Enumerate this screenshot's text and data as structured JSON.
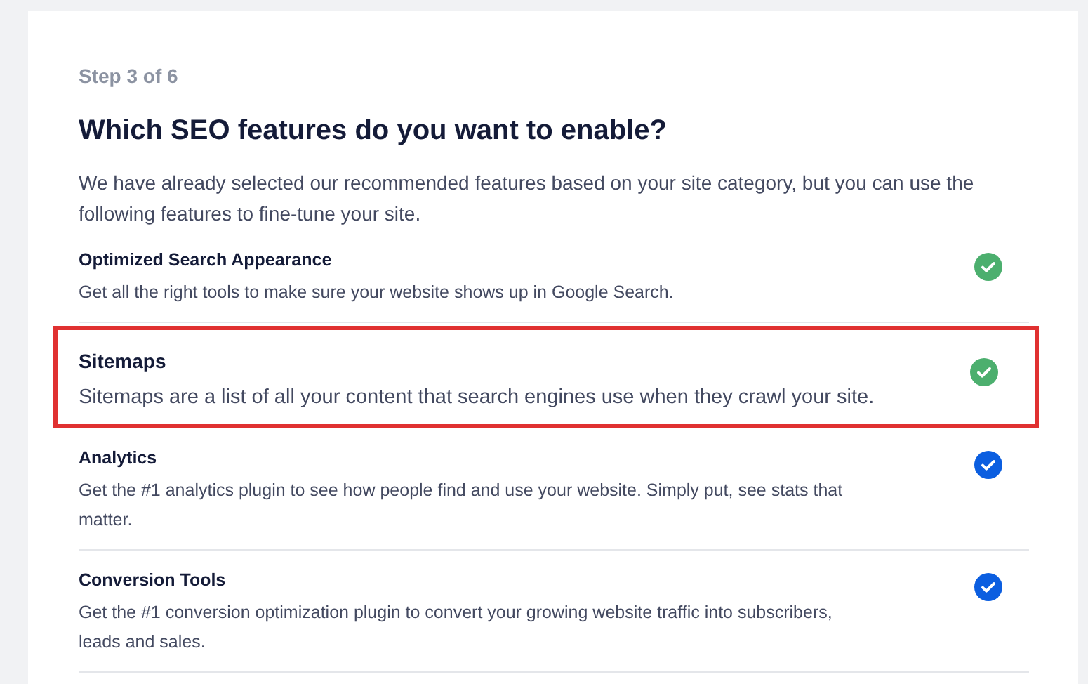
{
  "step": "Step 3 of 6",
  "title": "Which SEO features do you want to enable?",
  "intro": "We have already selected our recommended features based on your site category, but you can use the following features to fine-tune your site.",
  "features": [
    {
      "name": "Optimized Search Appearance",
      "description": "Get all the right tools to make sure your website shows up in Google Search.",
      "checked": true,
      "highlighted": false,
      "color": "#4caf6e"
    },
    {
      "name": "Sitemaps",
      "description": "Sitemaps are a list of all your content that search engines use when they crawl your site.",
      "checked": true,
      "highlighted": true,
      "color": "#4caf6e"
    },
    {
      "name": "Analytics",
      "description": "Get the #1 analytics plugin to see how people find and use your website. Simply put, see stats that matter.",
      "checked": true,
      "highlighted": false,
      "color": "#0b5ee0"
    },
    {
      "name": "Conversion Tools",
      "description": "Get the #1 conversion optimization plugin to convert your growing website traffic into subscribers, leads and sales.",
      "checked": true,
      "highlighted": false,
      "color": "#0b5ee0"
    }
  ]
}
